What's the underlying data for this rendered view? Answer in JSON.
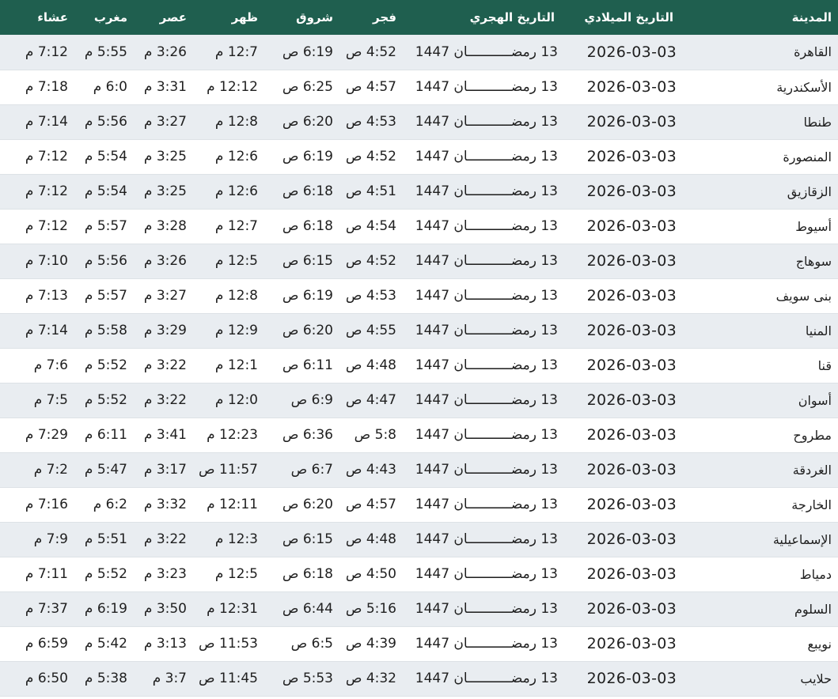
{
  "headers": [
    "المدينة",
    "التاريخ الميلادي",
    "التاريخ الهجري",
    "فجر",
    "شروق",
    "ظهر",
    "عصر",
    "مغرب",
    "عشاء"
  ],
  "rows": [
    [
      "القاهرة",
      "2026-03-03",
      "13 رمضـــــــــــان 1447",
      "4:52 ص",
      "6:19 ص",
      "12:7 م",
      "3:26 م",
      "5:55 م",
      "7:12 م"
    ],
    [
      "الأسكندرية",
      "2026-03-03",
      "13 رمضـــــــــــان 1447",
      "4:57 ص",
      "6:25 ص",
      "12:12 م",
      "3:31 م",
      "6:0 م",
      "7:18 م"
    ],
    [
      "طنطا",
      "2026-03-03",
      "13 رمضـــــــــــان 1447",
      "4:53 ص",
      "6:20 ص",
      "12:8 م",
      "3:27 م",
      "5:56 م",
      "7:14 م"
    ],
    [
      "المنصورة",
      "2026-03-03",
      "13 رمضـــــــــــان 1447",
      "4:52 ص",
      "6:19 ص",
      "12:6 م",
      "3:25 م",
      "5:54 م",
      "7:12 م"
    ],
    [
      "الزقازيق",
      "2026-03-03",
      "13 رمضـــــــــــان 1447",
      "4:51 ص",
      "6:18 ص",
      "12:6 م",
      "3:25 م",
      "5:54 م",
      "7:12 م"
    ],
    [
      "أسيوط",
      "2026-03-03",
      "13 رمضـــــــــــان 1447",
      "4:54 ص",
      "6:18 ص",
      "12:7 م",
      "3:28 م",
      "5:57 م",
      "7:12 م"
    ],
    [
      "سوهاج",
      "2026-03-03",
      "13 رمضـــــــــــان 1447",
      "4:52 ص",
      "6:15 ص",
      "12:5 م",
      "3:26 م",
      "5:56 م",
      "7:10 م"
    ],
    [
      "بنى سويف",
      "2026-03-03",
      "13 رمضـــــــــــان 1447",
      "4:53 ص",
      "6:19 ص",
      "12:8 م",
      "3:27 م",
      "5:57 م",
      "7:13 م"
    ],
    [
      "المنيا",
      "2026-03-03",
      "13 رمضـــــــــــان 1447",
      "4:55 ص",
      "6:20 ص",
      "12:9 م",
      "3:29 م",
      "5:58 م",
      "7:14 م"
    ],
    [
      "قنا",
      "2026-03-03",
      "13 رمضـــــــــــان 1447",
      "4:48 ص",
      "6:11 ص",
      "12:1 م",
      "3:22 م",
      "5:52 م",
      "7:6 م"
    ],
    [
      "أسوان",
      "2026-03-03",
      "13 رمضـــــــــــان 1447",
      "4:47 ص",
      "6:9 ص",
      "12:0 م",
      "3:22 م",
      "5:52 م",
      "7:5 م"
    ],
    [
      "مطروح",
      "2026-03-03",
      "13 رمضـــــــــــان 1447",
      "5:8 ص",
      "6:36 ص",
      "12:23 م",
      "3:41 م",
      "6:11 م",
      "7:29 م"
    ],
    [
      "الغردقة",
      "2026-03-03",
      "13 رمضـــــــــــان 1447",
      "4:43 ص",
      "6:7 ص",
      "11:57 ص",
      "3:17 م",
      "5:47 م",
      "7:2 م"
    ],
    [
      "الخارجة",
      "2026-03-03",
      "13 رمضـــــــــــان 1447",
      "4:57 ص",
      "6:20 ص",
      "12:11 م",
      "3:32 م",
      "6:2 م",
      "7:16 م"
    ],
    [
      "الإسماعيلية",
      "2026-03-03",
      "13 رمضـــــــــــان 1447",
      "4:48 ص",
      "6:15 ص",
      "12:3 م",
      "3:22 م",
      "5:51 م",
      "7:9 م"
    ],
    [
      "دمياط",
      "2026-03-03",
      "13 رمضـــــــــــان 1447",
      "4:50 ص",
      "6:18 ص",
      "12:5 م",
      "3:23 م",
      "5:52 م",
      "7:11 م"
    ],
    [
      "السلوم",
      "2026-03-03",
      "13 رمضـــــــــــان 1447",
      "5:16 ص",
      "6:44 ص",
      "12:31 م",
      "3:50 م",
      "6:19 م",
      "7:37 م"
    ],
    [
      "نويبع",
      "2026-03-03",
      "13 رمضـــــــــــان 1447",
      "4:39 ص",
      "6:5 ص",
      "11:53 ص",
      "3:13 م",
      "5:42 م",
      "6:59 م"
    ],
    [
      "حلايب",
      "2026-03-03",
      "13 رمضـــــــــــان 1447",
      "4:32 ص",
      "5:53 ص",
      "11:45 ص",
      "3:7 م",
      "5:38 م",
      "6:50 م"
    ]
  ],
  "colors": {
    "header_bg": "#1f5f4f",
    "header_text": "#ffffff",
    "row_odd_bg": "#e9edf1",
    "row_even_bg": "#ffffff"
  }
}
